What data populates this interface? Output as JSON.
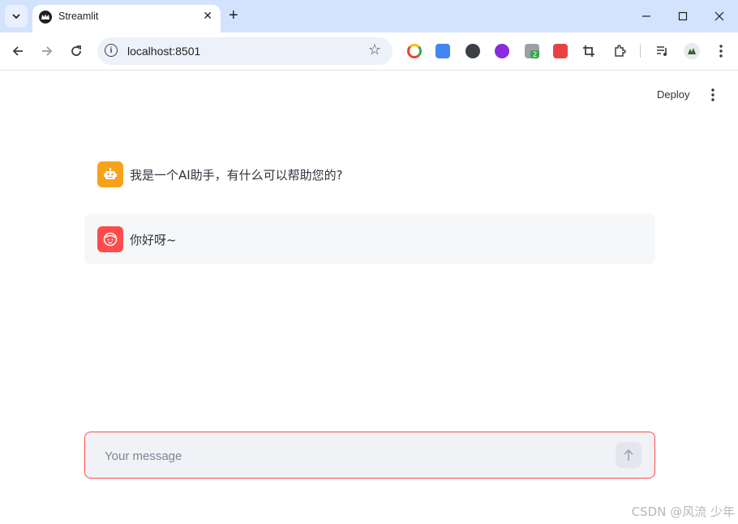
{
  "browser": {
    "tab_title": "Streamlit",
    "address": "localhost:8501",
    "extensions": [
      {
        "name": "chrome-ext-icon",
        "color": "#ea4335"
      },
      {
        "name": "translate-ext-icon",
        "color": "#4285f4"
      },
      {
        "name": "screenshot-ext-icon",
        "color": "#3c4043"
      },
      {
        "name": "code-ext-icon",
        "color": "#8a2be2"
      },
      {
        "name": "sheets-ext-icon",
        "color": "#34a853"
      },
      {
        "name": "pin-ext-icon",
        "color": "#e84142"
      }
    ],
    "ext_badge": "2"
  },
  "app": {
    "deploy_label": "Deploy",
    "messages": [
      {
        "role": "assistant",
        "text": "我是一个AI助手，有什么可以帮助您的?"
      },
      {
        "role": "user",
        "text": "你好呀~"
      }
    ],
    "input_placeholder": "Your message"
  },
  "colors": {
    "accent": "#ff4b4b",
    "assistant_avatar": "#f7a21b",
    "user_bubble": "#f6f7f9"
  },
  "watermark": "CSDN @风流 少年"
}
